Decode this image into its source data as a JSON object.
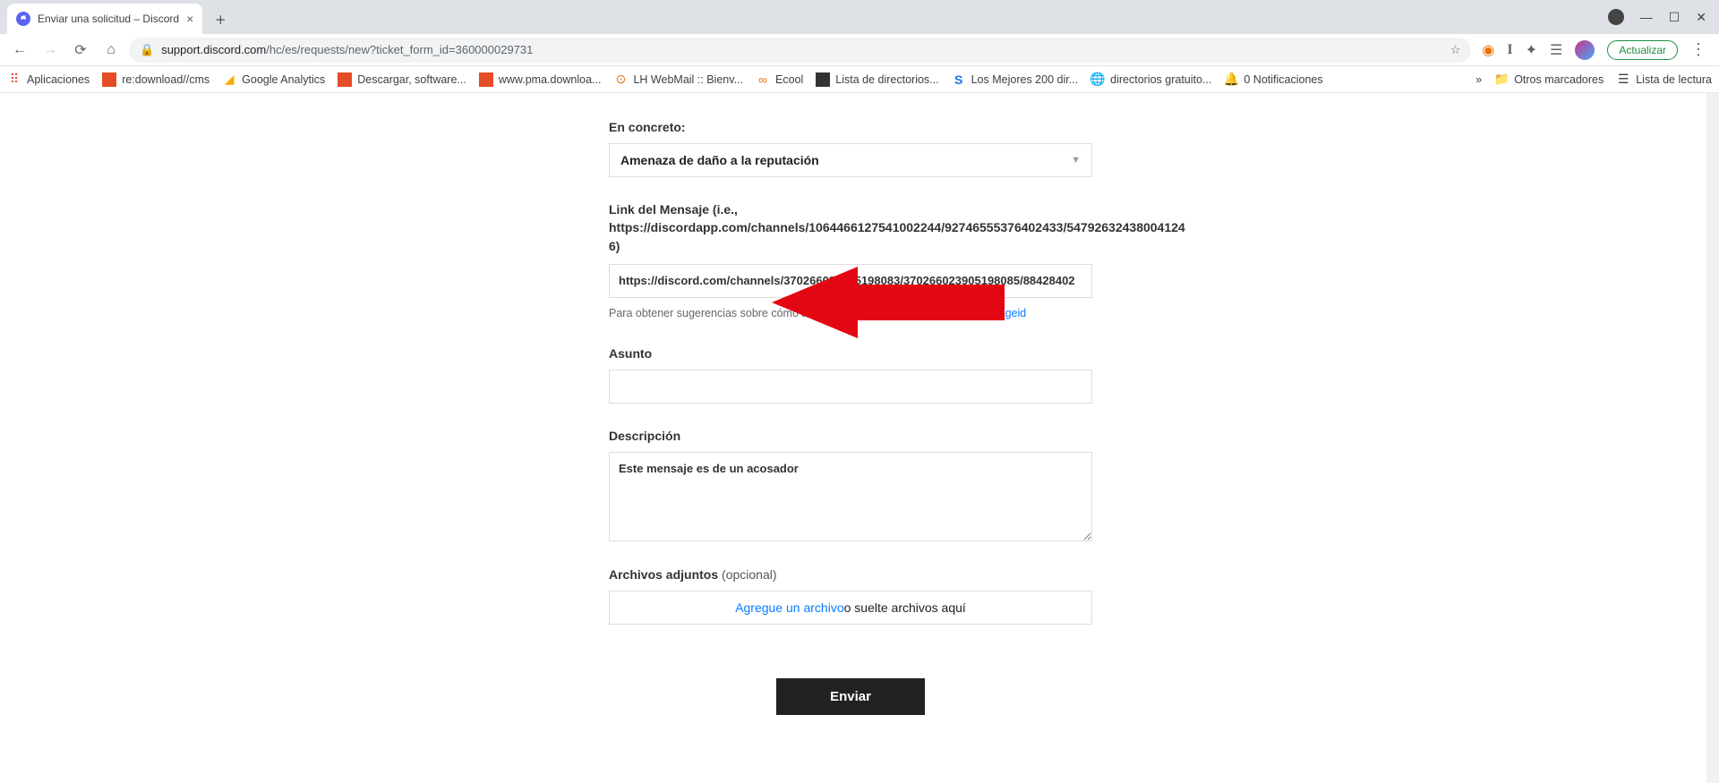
{
  "browser": {
    "tab_title": "Enviar una solicitud – Discord",
    "url_host": "support.discord.com",
    "url_path": "/hc/es/requests/new?ticket_form_id=360000029731",
    "update_label": "Actualizar"
  },
  "bookmarks": {
    "apps": "Aplicaciones",
    "items": [
      "re:download//cms",
      "Google Analytics",
      "Descargar, software...",
      "www.pma.downloa...",
      "LH WebMail :: Bienv...",
      "Ecool",
      "Lista de directorios...",
      "Los Mejores 200 dir...",
      "directorios gratuito...",
      "0 Notificaciones"
    ],
    "overflow": "»",
    "other": "Otros marcadores",
    "reading": "Lista de lectura"
  },
  "form": {
    "section_label": "En concreto:",
    "select_value": "Amenaza de daño a la reputación",
    "link_label": "Link del Mensaje (i.e.,",
    "link_example": "https://discordapp.com/channels/1064466127541002244/92746555376402433/54792632438004124​6)",
    "link_value": "https://discord.com/channels/370266023905198083/370266023905198085/88428402",
    "id_hint_prefix": "Para obtener sugerencias sobre cómo adquirir los ID, visite ",
    "id_hint_link": "https://dis.gd/messageid",
    "subject_label": "Asunto",
    "subject_value": "",
    "description_label": "Descripción",
    "description_value": "Este mensaje es de un acosador",
    "attach_label": "Archivos adjuntos",
    "attach_optional": "(opcional)",
    "attach_link": "Agregue un archivo",
    "attach_rest": " o suelte archivos aquí",
    "submit": "Enviar"
  }
}
